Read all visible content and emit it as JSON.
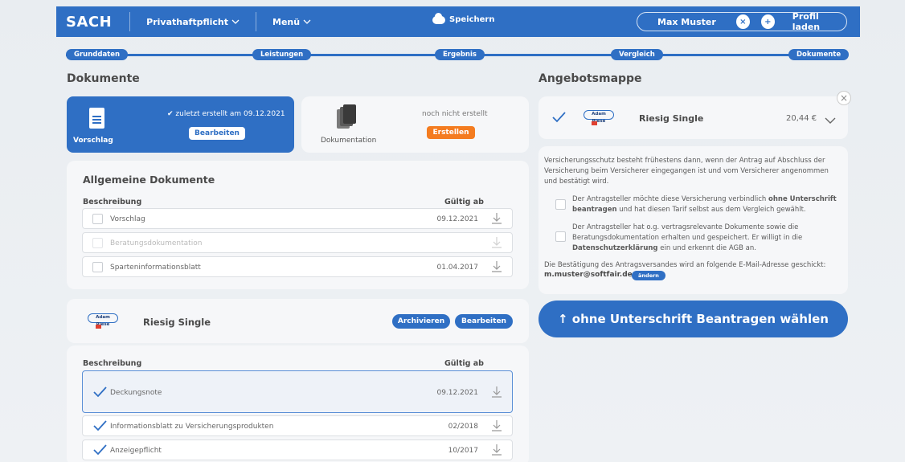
{
  "header": {
    "logo": "SACH",
    "menu1": "Privathaftpflicht",
    "menu2": "Menü",
    "save": "Speichern",
    "user": "Max Muster",
    "close": "×",
    "plus": "+",
    "load_profile": "Profil laden"
  },
  "steps": [
    "Grunddaten",
    "Leistungen",
    "Ergebnis",
    "Vergleich",
    "Dokumente"
  ],
  "left": {
    "title": "Dokumente",
    "vorschlag": {
      "status": "zuletzt erstellt am 09.12.2021",
      "edit": "Bearbeiten",
      "label": "Vorschlag"
    },
    "dokumentation": {
      "status": "noch nicht erstellt",
      "create": "Erstellen",
      "label": "Dokumentation"
    },
    "general": {
      "title": "Allgemeine Dokumente",
      "col_desc": "Beschreibung",
      "col_date": "Gültig ab",
      "rows": [
        {
          "label": "Vorschlag",
          "date": "09.12.2021"
        },
        {
          "label": "Beratungsdokumentation",
          "date": ""
        },
        {
          "label": "Sparteninformationsblatt",
          "date": "01.04.2017"
        }
      ]
    },
    "product": {
      "insurer_logo": "Adam Riese",
      "name": "Riesig Single",
      "archive": "Archivieren",
      "edit": "Bearbeiten",
      "col_desc": "Beschreibung",
      "col_date": "Gültig ab",
      "rows": [
        {
          "label": "Deckungsnote",
          "date": "09.12.2021"
        },
        {
          "label": "Informationsblatt zu Versicherungsprodukten",
          "date": "02/2018"
        },
        {
          "label": "Anzeigepflicht",
          "date": "10/2017"
        }
      ]
    }
  },
  "right": {
    "title": "Angebotsmappe",
    "offer": {
      "insurer_logo": "Adam Riese",
      "name": "Riesig Single",
      "price": "20,44 €",
      "remove": "×"
    },
    "info_text": "Versicherungsschutz besteht frühestens dann, wenn der Antrag auf Abschluss der Versicherung beim Versicherer eingegangen ist und vom Versicherer angenommen und bestätigt wird.",
    "option1_a": "Der Antragsteller möchte diese Versicherung verbindlich ",
    "option1_b": "ohne Unterschrift beantragen",
    "option1_c": " und hat diesen Tarif selbst aus dem Vergleich gewählt.",
    "option2_a": "Der Antragsteller hat o.g. vertragsrelevante Dokumente sowie die Beratungsdokumentation erhalten und gespeichert. Er willigt in die ",
    "option2_b": "Datenschutzerklärung",
    "option2_c": " ein und erkennt die AGB an.",
    "email_note": "Die Bestätigung des Antragsversandes wird an folgende E-Mail-Adresse geschickt:",
    "email": "m.muster@softfair.de",
    "change": "ändern",
    "submit": "↑ ohne Unterschrift Beantragen wählen"
  },
  "colors": {
    "primary": "#2f6fc4",
    "accent": "#f47c20"
  }
}
